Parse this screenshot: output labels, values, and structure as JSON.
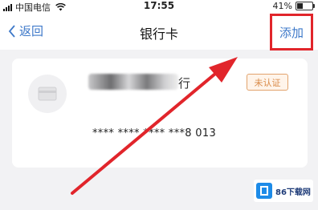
{
  "status_bar": {
    "carrier": "中国电信",
    "time": "17:55",
    "battery_text": "41%",
    "battery_level": 0.41
  },
  "nav": {
    "back_label": "返回",
    "title": "银行卡",
    "add_label": "添加"
  },
  "card": {
    "bank_name": "行",
    "status_badge": "未认证",
    "card_number": "**** **** **** ***8 013"
  },
  "annotation": {
    "highlight_color": "#e1252b",
    "arrow_color": "#e1252b"
  },
  "watermark": {
    "text": "86下载网",
    "logo_color": "#1d8be8"
  }
}
